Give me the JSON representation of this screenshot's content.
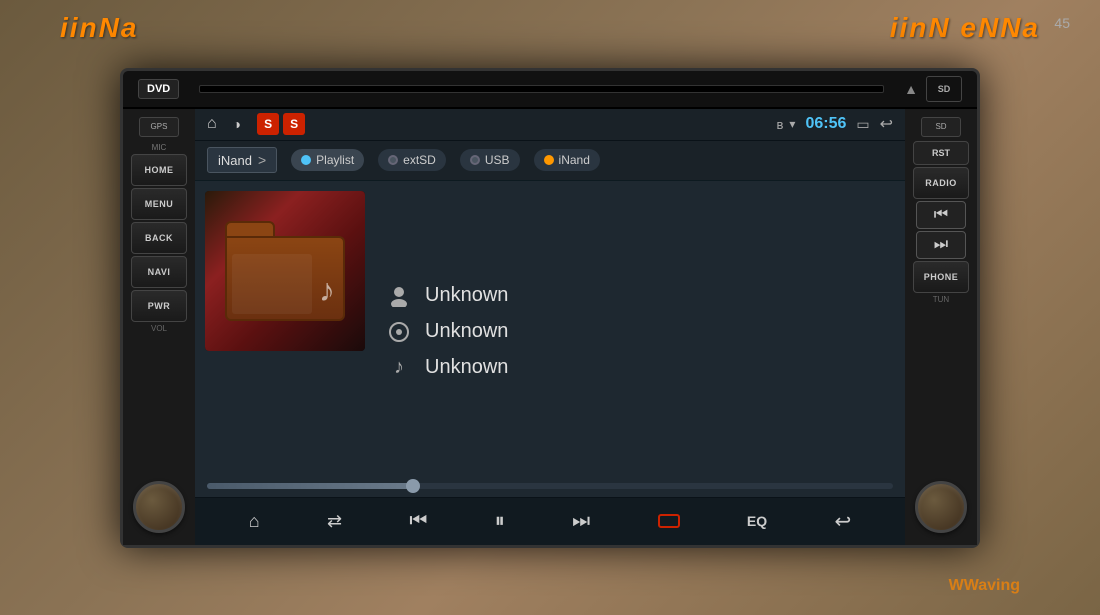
{
  "outer": {
    "brand_top_left": "iinNa",
    "brand_top_right": "iinN eNNa",
    "brand_bottom_right": "Waving",
    "corner_label": "45"
  },
  "unit": {
    "top": {
      "dvd_label": "DVD",
      "eject": "▲",
      "sd_label": "SD"
    },
    "left_panel": {
      "gps": "GPS",
      "mic": "MIC",
      "buttons": [
        "HOME",
        "MENU",
        "BACK",
        "NAVI",
        "PWR"
      ],
      "knob_label": "VOL"
    },
    "right_panel": {
      "sd": "SD",
      "rst": "RST",
      "buttons": [
        "RADIO",
        "PHONE"
      ],
      "nav_prev": "⏮",
      "nav_next": "⏭",
      "knob_label": "TUN"
    },
    "status_bar": {
      "home_icon": "⌂",
      "brightness_icon": "◑",
      "ss1": "S",
      "ss2": "S",
      "time": "06:56",
      "bt_icon": "B",
      "wifi_icon": "▾",
      "back_icon": "↩"
    },
    "source_bar": {
      "inand_label": "iNand",
      "arrow": ">",
      "tabs": [
        {
          "label": "Playlist",
          "dot_type": "active"
        },
        {
          "label": "extSD",
          "dot_type": "normal"
        },
        {
          "label": "USB",
          "dot_type": "normal"
        },
        {
          "label": "iNand",
          "dot_type": "inand"
        }
      ]
    },
    "track_info": {
      "artist_label": "Unknown",
      "artist_icon": "👤",
      "album_label": "Unknown",
      "album_icon": "●",
      "title_label": "Unknown",
      "title_icon": "♪"
    },
    "progress": {
      "fill_percent": 30
    },
    "controls": {
      "home": "⌂",
      "shuffle": "⇄",
      "prev": "⏮",
      "play_pause": "⏸",
      "next": "⏭",
      "stop": "⬛",
      "eq": "EQ",
      "back": "↩"
    }
  }
}
